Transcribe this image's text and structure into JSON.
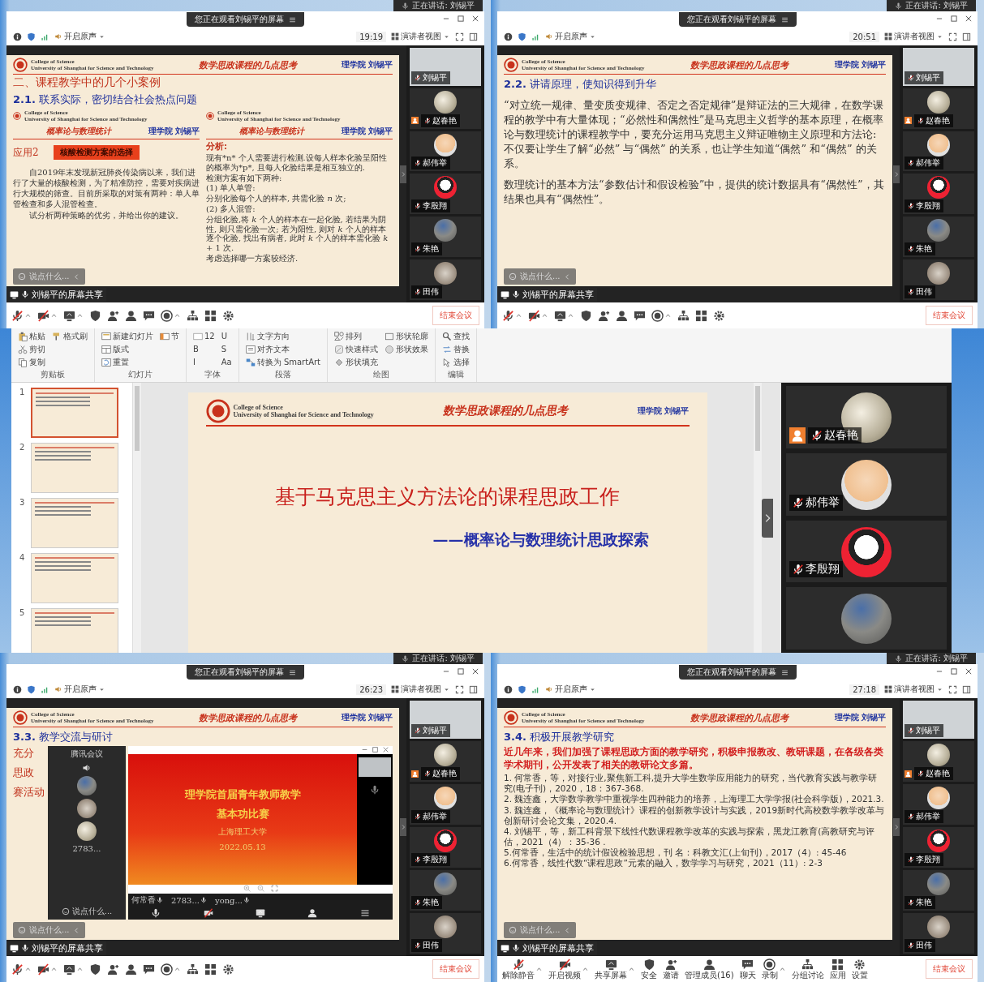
{
  "meetings": [
    {
      "speaking": "正在讲话: 刘锡平",
      "banner": "您正在观看刘锡平的屏幕",
      "toolbar": {
        "audio": "开启原声",
        "time": "19:19",
        "view": "演讲者视图"
      },
      "slide": {
        "header": {
          "college": "College of Science",
          "university": "University of Shanghai for Science and Technology",
          "title": "数学思政课程的几点思考",
          "author": "理学院 刘锡平"
        },
        "blocks": [
          {
            "kind": "section",
            "text": "二、课程教学中的几个小案例"
          },
          {
            "kind": "heading",
            "text": "**2.1.** 联系实际，密切结合社会热点问题"
          },
          {
            "kind": "columns",
            "columns": [
              {
                "header": {
                  "college": "College of Science",
                  "university": "University of Shanghai for Science and Technology",
                  "title": "概率论与数理统计",
                  "author": "理学院 刘锡平"
                },
                "blocks": [
                  {
                    "kind": "case",
                    "label": "应用2",
                    "tag": "核酸检测方案的选择"
                  },
                  {
                    "kind": "para",
                    "text": "自2019年末发现新冠肺炎传染病以来，我们进行了大量的核酸检测，为了精准防控，需要对疾病进行大规模的筛查。目前所采取的对策有两种：单人单管检查和多人混管检查。"
                  },
                  {
                    "kind": "para",
                    "text": "试分析两种策略的优劣，并给出你的建议。"
                  }
                ]
              },
              {
                "header": {
                  "college": "College of Science",
                  "university": "University of Shanghai for Science and Technology",
                  "title": "概率论与数理统计",
                  "author": "理学院 刘锡平"
                },
                "blocks": [
                  {
                    "kind": "red-label",
                    "text": "分析:"
                  },
                  {
                    "kind": "line",
                    "text": "现有*n* 个人需要进行检测.设每人样本化验呈阳性的概率为*p*, 且每人化验结果是相互独立的."
                  },
                  {
                    "kind": "line",
                    "text": "检测方案有如下两种:"
                  },
                  {
                    "kind": "line",
                    "text": "(1) 单人单管:"
                  },
                  {
                    "kind": "line",
                    "text": "分别化验每个人的样本, 共需化验 *n* 次;"
                  },
                  {
                    "kind": "line",
                    "text": "(2) 多人混管:"
                  },
                  {
                    "kind": "line",
                    "text": "分组化验,将 *k* 个人的样本在一起化验, 若结果为阴性, 则只需化验一次; 若为阳性, 则对 *k* 个人的样本逐个化验, 找出有病者, 此时 *k* 个人的样本需化验 *k* + 1 次."
                  },
                  {
                    "kind": "line",
                    "text": "考虑选择哪一方案较经济."
                  }
                ]
              }
            ]
          }
        ]
      },
      "chat": "说点什么...",
      "share": "刘锡平的屏幕共享",
      "participants": [
        {
          "kind": "video",
          "name": "刘锡平",
          "host": false
        },
        {
          "kind": "avatar",
          "name": "赵春艳",
          "host": true
        },
        {
          "kind": "avatar",
          "name": "郝伟举",
          "host": false
        },
        {
          "kind": "avatar",
          "name": "李殷翔",
          "host": false
        },
        {
          "kind": "avatar",
          "name": "朱艳",
          "host": false
        },
        {
          "kind": "avatar",
          "name": "田伟",
          "host": false
        }
      ],
      "end_button": "结束会议"
    },
    {
      "speaking": "正在讲话: 刘锡平",
      "banner": "您正在观看刘锡平的屏幕",
      "toolbar": {
        "audio": "开启原声",
        "time": "20:51",
        "view": "演讲者视图"
      },
      "slide": {
        "header": {
          "college": "College of Science",
          "university": "University of Shanghai for Science and Technology",
          "title": "数学思政课程的几点思考",
          "author": "理学院 刘锡平"
        },
        "blocks": [
          {
            "kind": "heading",
            "text": "**2.2.** 讲请原理，使知识得到升华"
          },
          {
            "kind": "big-para",
            "text": "“对立统一规律、量变质变规律、否定之否定规律”是辩证法的三大规律，在数学课程的教学中有大量体现；“必然性和偶然性”是马克思主义哲学的基本原理，在概率论与数理统计的课程教学中，要充分运用马克思主义辩证唯物主义原理和方法论:不仅要让学生了解“必然” 与“偶然” 的关系，也让学生知道“偶然” 和“偶然” 的关系。"
          },
          {
            "kind": "big-para",
            "text": "数理统计的基本方法“参数估计和假设检验”中，提供的统计数据具有“偶然性”，其结果也具有“偶然性”。"
          }
        ]
      },
      "chat": "说点什么...",
      "share": "刘锡平的屏幕共享",
      "participants": [
        {
          "kind": "video",
          "name": "刘锡平",
          "host": false
        },
        {
          "kind": "avatar",
          "name": "赵春艳",
          "host": true
        },
        {
          "kind": "avatar",
          "name": "郝伟举",
          "host": false
        },
        {
          "kind": "avatar",
          "name": "李殷翔",
          "host": false
        },
        {
          "kind": "avatar",
          "name": "朱艳",
          "host": false
        },
        {
          "kind": "avatar",
          "name": "田伟",
          "host": false
        }
      ],
      "end_button": "结束会议"
    },
    {
      "speaking": "正在讲话: 刘锡平",
      "banner": "您正在观看刘锡平的屏幕",
      "toolbar": {
        "audio": "开启原声",
        "time": "26:23",
        "view": "演讲者视图"
      },
      "slide": {
        "header": {
          "college": "College of Science",
          "university": "University of Shanghai for Science and Technology",
          "title": "数学思政课程的几点思考",
          "author": "理学院 刘锡平"
        },
        "blocks": [
          {
            "kind": "heading",
            "text": "**3.3.** 教学交流与研讨"
          },
          {
            "kind": "contest",
            "fragments": [
              "充分",
              "思政",
              "赛活动"
            ],
            "phone": {
              "app": "腾讯会议",
              "attendees": [
                {
                  "kind": "avatar"
                },
                {
                  "kind": "avatar"
                },
                {
                  "kind": "avatar",
                  "name": "2783..."
                }
              ],
              "chat": "说点什么..."
            },
            "window": {
              "title": "理学院首届青年教师教学",
              "subtitle": "基本功比赛",
              "org": "上海理工大学",
              "date": "2022.05.13",
              "names": [
                "何常香",
                "2783...",
                "yong..."
              ]
            }
          }
        ]
      },
      "chat": "说点什么...",
      "share": "刘锡平的屏幕共享",
      "participants": [
        {
          "kind": "video",
          "name": "刘锡平",
          "host": false
        },
        {
          "kind": "avatar",
          "name": "赵春艳",
          "host": true
        },
        {
          "kind": "avatar",
          "name": "郝伟举",
          "host": false
        },
        {
          "kind": "avatar",
          "name": "李殷翔",
          "host": false
        },
        {
          "kind": "avatar",
          "name": "朱艳",
          "host": false
        },
        {
          "kind": "avatar",
          "name": "田伟",
          "host": false
        }
      ],
      "end_button": "结束会议"
    },
    {
      "speaking": "正在讲话: 刘锡平",
      "banner": "您正在观看刘锡平的屏幕",
      "toolbar": {
        "audio": "开启原声",
        "time": "27:18",
        "view": "演讲者视图"
      },
      "slide": {
        "header": {
          "college": "College of Science",
          "university": "University of Shanghai for Science and Technology",
          "title": "数学思政课程的几点思考",
          "author": "理学院 刘锡平"
        },
        "blocks": [
          {
            "kind": "heading",
            "text": "**3.4.** 积极开展教学研究"
          },
          {
            "kind": "red-para",
            "text": "近几年来，我们加强了课程思政方面的教学研究，积极申报教改、教研课题，在各级各类学术期刊，公开发表了相关的教研论文多篇。"
          },
          {
            "kind": "item",
            "text": "1. 何常香，等，对接行业,聚焦新工科,提升大学生数学应用能力的研究，当代教育实践与教学研究(电子刊)，2020，18：367-368."
          },
          {
            "kind": "item",
            "text": "2. 魏连鑫，大学数学教学中重视学生四种能力的培养，上海理工大学学报(社会科学版)，2021.3."
          },
          {
            "kind": "item",
            "text": "3. 魏连鑫，《概率论与数理统计》课程的创新教学设计与实践，2019新时代高校数学教学改革与创新研讨会论文集，2020.4."
          },
          {
            "kind": "item",
            "text": "4. 刘锡平，等，新工科背景下线性代数课程教学改革的实践与探索，黑龙江教育(高教研究与评估，2021（4）：35-36 ."
          },
          {
            "kind": "item",
            "text": "5.何常香，生活中的统计假设检验思想，刊 名：科教文汇(上旬刊)，2017（4）: 45-46"
          },
          {
            "kind": "item",
            "text": "6.何常香，线性代数“课程思政”元素的融入，数学学习与研究，2021（11）: 2-3"
          }
        ]
      },
      "chat": "说点什么...",
      "share": "刘锡平的屏幕共享",
      "participants": [
        {
          "kind": "video",
          "name": "刘锡平",
          "host": false
        },
        {
          "kind": "avatar",
          "name": "赵春艳",
          "host": true
        },
        {
          "kind": "avatar",
          "name": "郝伟举",
          "host": false
        },
        {
          "kind": "avatar",
          "name": "李殷翔",
          "host": false
        },
        {
          "kind": "avatar",
          "name": "朱艳",
          "host": false
        },
        {
          "kind": "avatar",
          "name": "田伟",
          "host": false
        }
      ],
      "controls": [
        "解除静音",
        "开启视频",
        "共享屏幕",
        "安全",
        "邀请",
        "管理成员(16)",
        "聊天",
        "录制",
        "分组讨论",
        "应用",
        "设置"
      ],
      "end_button": "结束会议"
    }
  ],
  "editor": {
    "ribbon": [
      {
        "label": "剪贴板",
        "items": [
          "粘贴",
          "剪切",
          "复制",
          "格式刷"
        ]
      },
      {
        "label": "幻灯片",
        "items": [
          "新建幻灯片",
          "版式",
          "重置",
          "节"
        ]
      },
      {
        "label": "字体",
        "items": [
          "12",
          "B",
          "I",
          "U",
          "S",
          "Aa"
        ]
      },
      {
        "label": "段落",
        "items": [
          "文字方向",
          "对齐文本",
          "转换为 SmartArt"
        ]
      },
      {
        "label": "绘图",
        "items": [
          "排列",
          "快速样式",
          "形状填充",
          "形状轮廓",
          "形状效果"
        ]
      },
      {
        "label": "编辑",
        "items": [
          "查找",
          "替换",
          "选择"
        ]
      }
    ],
    "thumbnails": [
      {
        "number": "1",
        "selected": true
      },
      {
        "number": "2",
        "selected": false
      },
      {
        "number": "3",
        "selected": false
      },
      {
        "number": "4",
        "selected": false
      },
      {
        "number": "5",
        "selected": false
      }
    ],
    "slide": {
      "header": {
        "college": "College of Science",
        "university": "University of Shanghai for Science and Technology",
        "title": "数学思政课程的几点思考",
        "author": "理学院 刘锡平"
      },
      "blocks": [
        {
          "kind": "title",
          "text": "基于马克思主义方法论的课程思政工作"
        },
        {
          "kind": "subtitle",
          "text": "——概率论与数理统计思政探索"
        }
      ]
    },
    "participants": [
      {
        "kind": "avatar",
        "name": "赵春艳",
        "host": true
      },
      {
        "kind": "avatar",
        "name": "郝伟举",
        "host": false
      },
      {
        "kind": "avatar",
        "name": "李殷翔",
        "host": false
      },
      {
        "kind": "avatar",
        "host": false
      }
    ]
  }
}
